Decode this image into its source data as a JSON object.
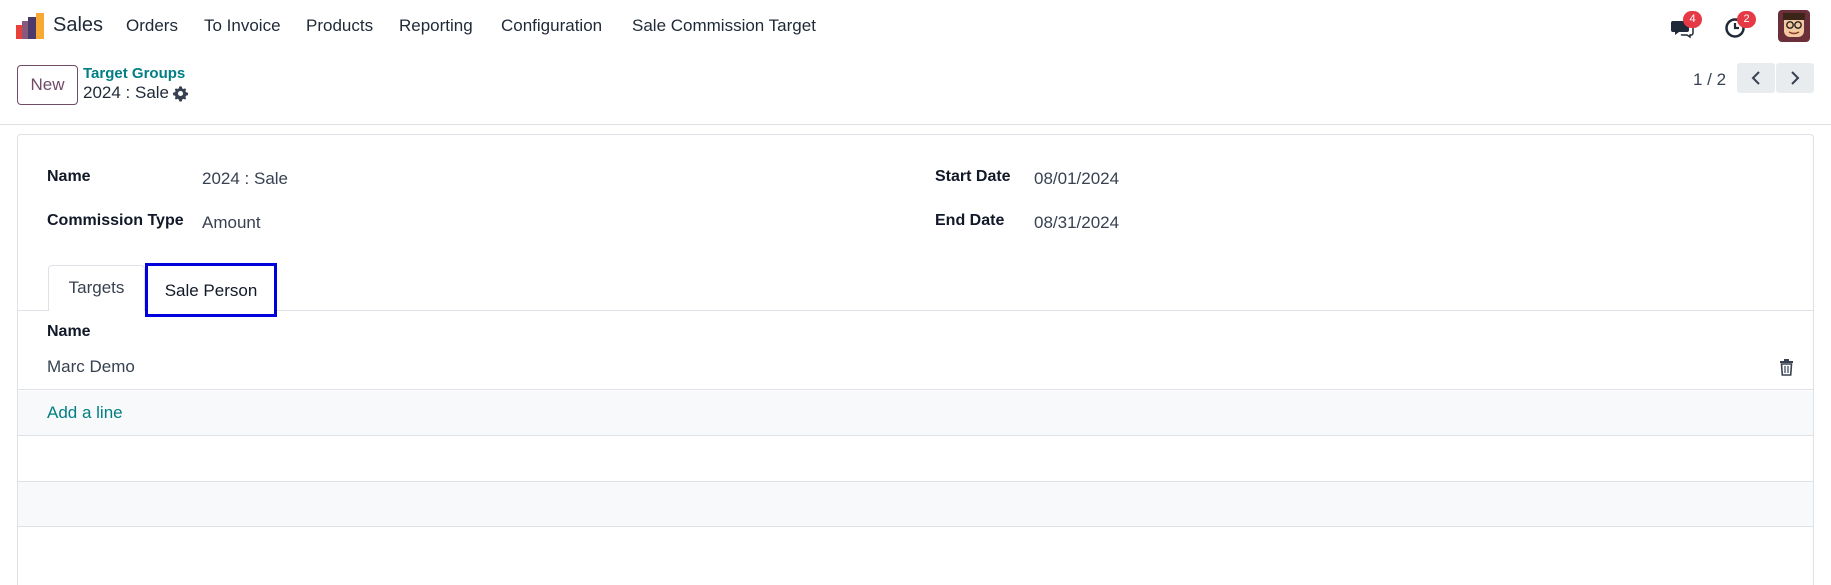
{
  "navbar": {
    "app_name": "Sales",
    "menu": [
      "Orders",
      "To Invoice",
      "Products",
      "Reporting",
      "Configuration",
      "Sale Commission Target"
    ],
    "messages_badge": "4",
    "activities_badge": "2",
    "logo_colors": [
      "#e8413b",
      "#f7a934",
      "#875a7b",
      "#4c3a6b"
    ]
  },
  "control_panel": {
    "new_label": "New",
    "breadcrumb_parent": "Target Groups",
    "breadcrumb_current": "2024 : Sale",
    "pager": "1 / 2"
  },
  "form": {
    "name_label": "Name",
    "name_value": "2024 : Sale",
    "commission_type_label": "Commission Type",
    "commission_type_value": "Amount",
    "start_date_label": "Start Date",
    "start_date_value": "08/01/2024",
    "end_date_label": "End Date",
    "end_date_value": "08/31/2024"
  },
  "tabs": [
    {
      "label": "Targets",
      "active": false
    },
    {
      "label": "Sale Person",
      "active": true
    }
  ],
  "list": {
    "column_header": "Name",
    "rows": [
      "Marc Demo"
    ],
    "add_line_label": "Add a line"
  },
  "colors": {
    "brand": "#714B67",
    "link": "#017e84",
    "highlight_box": "#0000dd",
    "badge": "#e63946"
  }
}
